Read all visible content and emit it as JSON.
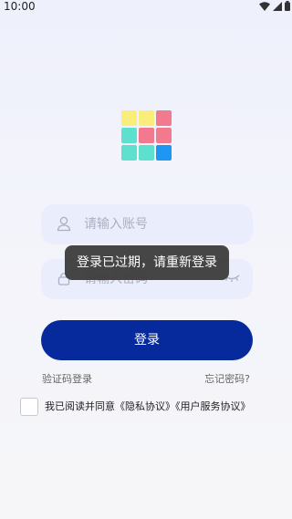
{
  "status_bar": {
    "time": "10:00"
  },
  "logo": {
    "colors": [
      "#faee7a",
      "#faee7a",
      "#f27a8e",
      "#5de0cd",
      "#f27a8e",
      "#f27a8e",
      "#5de0cd",
      "#5de0cd",
      "#1e96f2"
    ]
  },
  "form": {
    "username_placeholder": "请输入账号",
    "password_placeholder": "请输入密码",
    "login_button": "登录",
    "sms_login_link": "验证码登录",
    "forgot_password_link": "忘记密码?"
  },
  "agreement": {
    "text": "我已阅读并同意《隐私协议》《用户服务协议》",
    "checked": false
  },
  "toast": {
    "message": "登录已过期，请重新登录"
  },
  "colors": {
    "primary": "#06299b",
    "field_bg": "#eaedfb",
    "toast_bg": "#3c3c3c"
  }
}
